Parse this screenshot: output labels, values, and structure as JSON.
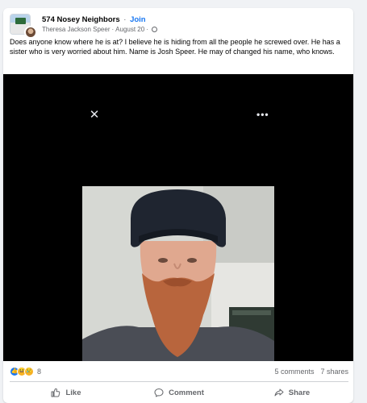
{
  "post": {
    "group_name": "574 Nosey Neighbors",
    "join_label": "Join",
    "author": "Theresa Jackson Speer",
    "date": "August 20",
    "separator": "·",
    "body": "Does anyone know where he is at?  I believe he is hiding from all the people he screwed over.  He has a sister who is very worried about him.  Name is Josh Speer.   He may of changed his name, who knows."
  },
  "viewer": {
    "close_glyph": "✕",
    "more_glyph": "•••"
  },
  "reactions": {
    "count": "8",
    "icons": [
      "like-icon",
      "haha-icon",
      "sad-icon"
    ],
    "comments": "5 comments",
    "shares": "7 shares"
  },
  "actions": {
    "like": "Like",
    "comment": "Comment",
    "share": "Share"
  },
  "colors": {
    "link": "#1877f2",
    "muted": "#65676b",
    "media_bg": "#000000"
  }
}
